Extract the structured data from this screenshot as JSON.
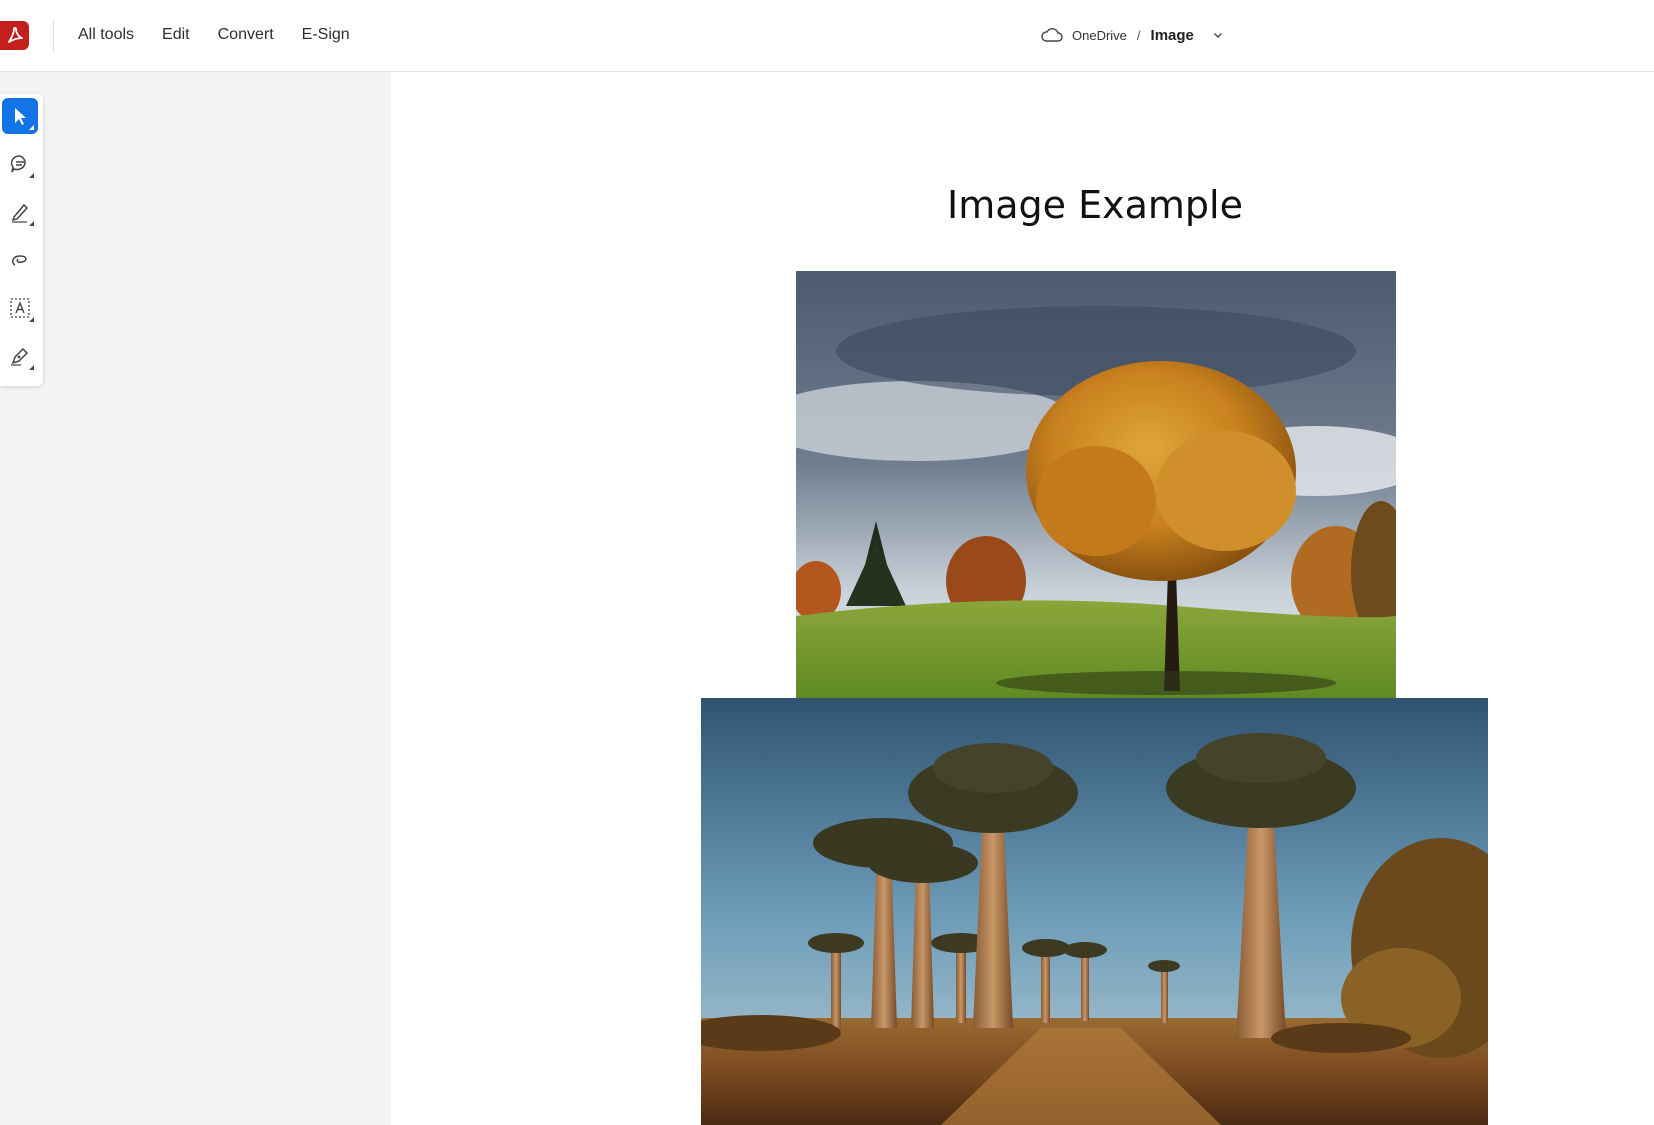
{
  "menu": {
    "items": [
      {
        "label": "All tools"
      },
      {
        "label": "Edit"
      },
      {
        "label": "Convert"
      },
      {
        "label": "E-Sign"
      }
    ]
  },
  "breadcrumb": {
    "root": "OneDrive",
    "separator": "/",
    "file": "Image"
  },
  "toolbar": {
    "tools": [
      {
        "icon": "select-cursor-icon",
        "active": true
      },
      {
        "icon": "comment-icon",
        "active": false
      },
      {
        "icon": "highlight-pen-icon",
        "active": false
      },
      {
        "icon": "draw-freehand-icon",
        "active": false
      },
      {
        "icon": "text-select-icon",
        "active": false
      },
      {
        "icon": "sign-pen-icon",
        "active": false
      }
    ]
  },
  "document": {
    "title": "Image Example",
    "images": [
      {
        "name": "autumn-tree-image"
      },
      {
        "name": "baobab-avenue-image"
      }
    ]
  },
  "colors": {
    "accent": "#1473e6",
    "brand": "#c41f1f",
    "left_pane_bg": "#f4f4f4"
  }
}
